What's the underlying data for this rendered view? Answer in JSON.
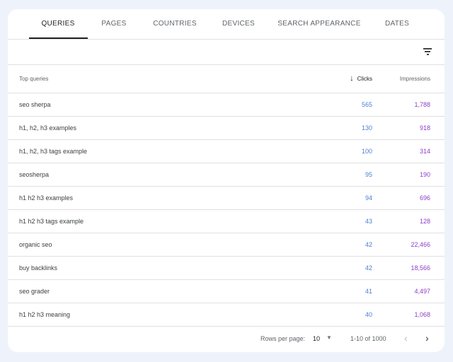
{
  "tabs": [
    "QUERIES",
    "PAGES",
    "COUNTRIES",
    "DEVICES",
    "SEARCH APPEARANCE",
    "DATES"
  ],
  "table": {
    "headers": {
      "query": "Top queries",
      "clicks": "Clicks",
      "impressions": "Impressions"
    },
    "rows": [
      {
        "query": "seo sherpa",
        "clicks": "565",
        "impressions": "1,788"
      },
      {
        "query": "h1, h2, h3 examples",
        "clicks": "130",
        "impressions": "918"
      },
      {
        "query": "h1, h2, h3 tags example",
        "clicks": "100",
        "impressions": "314"
      },
      {
        "query": "seosherpa",
        "clicks": "95",
        "impressions": "190"
      },
      {
        "query": "h1 h2 h3 examples",
        "clicks": "94",
        "impressions": "696"
      },
      {
        "query": "h1 h2 h3 tags example",
        "clicks": "43",
        "impressions": "128"
      },
      {
        "query": "organic seo",
        "clicks": "42",
        "impressions": "22,466"
      },
      {
        "query": "buy backlinks",
        "clicks": "42",
        "impressions": "18,566"
      },
      {
        "query": "seo grader",
        "clicks": "41",
        "impressions": "4,497"
      },
      {
        "query": "h1 h2 h3 meaning",
        "clicks": "40",
        "impressions": "1,068"
      }
    ]
  },
  "footer": {
    "rows_per_page_label": "Rows per page:",
    "rows_per_page": "10",
    "range": "1-10 of 1000"
  },
  "colors": {
    "clicks": "#4a7fd6",
    "impressions": "#8e3dc8"
  }
}
